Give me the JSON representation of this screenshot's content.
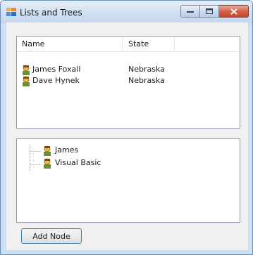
{
  "window": {
    "title": "Lists and Trees",
    "icon": "winforms-app-icon",
    "controls": [
      "minimize-icon",
      "maximize-icon",
      "close-icon"
    ],
    "colors": {
      "close_button": "#d6624b",
      "frame": "#cfdff0"
    }
  },
  "listview": {
    "columns": [
      "Name",
      "State"
    ],
    "rows": [
      {
        "icon": "user-icon",
        "name": "James Foxall",
        "state": "Nebraska"
      },
      {
        "icon": "user-icon",
        "name": "Dave Hynek",
        "state": "Nebraska"
      }
    ]
  },
  "treeview": {
    "nodes": [
      {
        "icon": "user-icon",
        "label": "James"
      },
      {
        "icon": "user-icon",
        "label": "Visual Basic"
      }
    ]
  },
  "buttons": {
    "add_node": "Add Node"
  }
}
